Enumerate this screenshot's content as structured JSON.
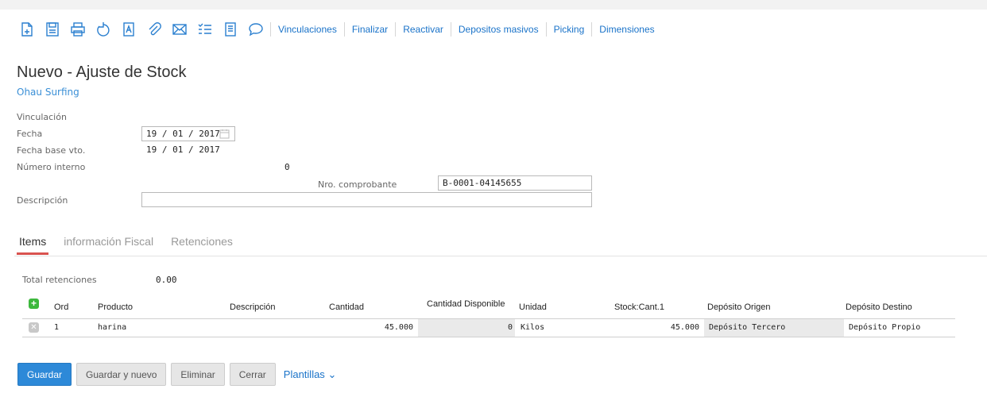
{
  "toolbar": {
    "icons": [
      "new-document-icon",
      "save-icon",
      "print-icon",
      "undo-icon",
      "text-field-icon",
      "attachment-icon",
      "email-icon",
      "checklist-icon",
      "notes-icon",
      "comment-icon"
    ],
    "links": [
      "Vinculaciones",
      "Finalizar",
      "Reactivar",
      "Depositos masivos",
      "Picking",
      "Dimensiones"
    ]
  },
  "header": {
    "title": "Nuevo - Ajuste de Stock",
    "subtitle": "Ohau Surfing"
  },
  "form": {
    "vinculacion_label": "Vinculación",
    "fecha_label": "Fecha",
    "fecha_value": "19 / 01 / 2017",
    "fecha_base_label": "Fecha base vto.",
    "fecha_base_value": "19 / 01 / 2017",
    "numero_interno_label": "Número interno",
    "numero_interno_value": "0",
    "nro_comprobante_label": "Nro. comprobante",
    "nro_comprobante_value": "B-0001-04145655",
    "descripcion_label": "Descripción",
    "descripcion_value": ""
  },
  "tabs": [
    {
      "label": "Items",
      "active": true
    },
    {
      "label": "información Fiscal",
      "active": false
    },
    {
      "label": "Retenciones",
      "active": false
    }
  ],
  "retenciones": {
    "label": "Total retenciones",
    "value": "0.00"
  },
  "grid": {
    "columns": [
      "Ord",
      "Producto",
      "Descripción",
      "Cantidad",
      "Cantidad Disponible",
      "Unidad",
      "Stock:Cant.1",
      "Depósito Origen",
      "Depósito Destino"
    ],
    "rows": [
      {
        "ord": "1",
        "producto": "harina",
        "descripcion": "",
        "cantidad": "45.000",
        "disponible": "0",
        "unidad": "Kilos",
        "stock": "45.000",
        "origen": "Depósito Tercero",
        "destino": "Depósito Propio"
      }
    ]
  },
  "buttons": {
    "guardar": "Guardar",
    "guardar_nuevo": "Guardar y nuevo",
    "eliminar": "Eliminar",
    "cerrar": "Cerrar",
    "plantillas": "Plantillas"
  },
  "colors": {
    "link": "#1a73c9",
    "primary": "#2d89d8",
    "tab_active": "#d9534f",
    "add": "#3db83d"
  }
}
